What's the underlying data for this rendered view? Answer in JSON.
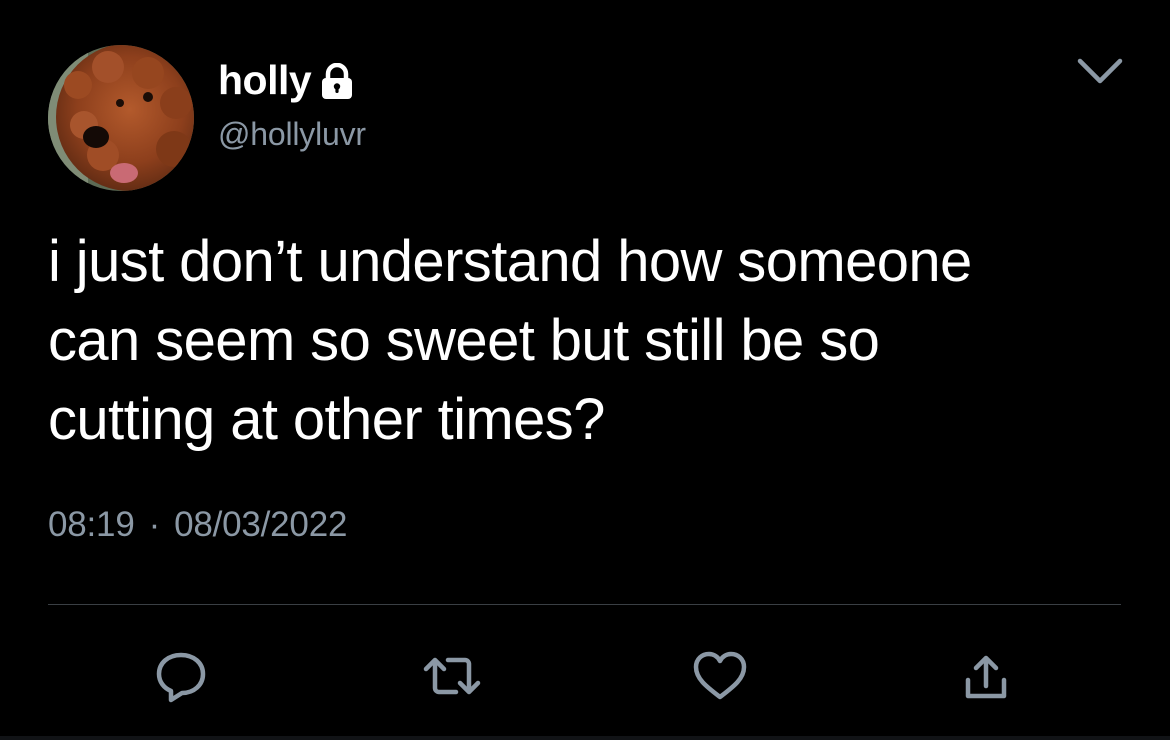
{
  "user": {
    "display_name": "holly",
    "handle": "@hollyluvr",
    "avatar": "poodle-photo"
  },
  "tweet": {
    "text": "i just don’t understand how someone\ncan seem so sweet but still be so\ncutting at other times?",
    "time": "08:19",
    "separator": "·",
    "date": "08/03/2022"
  },
  "icons": {
    "protected": "lock-icon",
    "menu": "chevron-down-icon",
    "reply": "reply-icon",
    "retweet": "retweet-icon",
    "like": "heart-icon",
    "share": "share-icon"
  },
  "colors": {
    "background": "#000000",
    "text": "#ffffff",
    "secondary_text": "#8b98a5",
    "divider": "#3a3f44"
  }
}
